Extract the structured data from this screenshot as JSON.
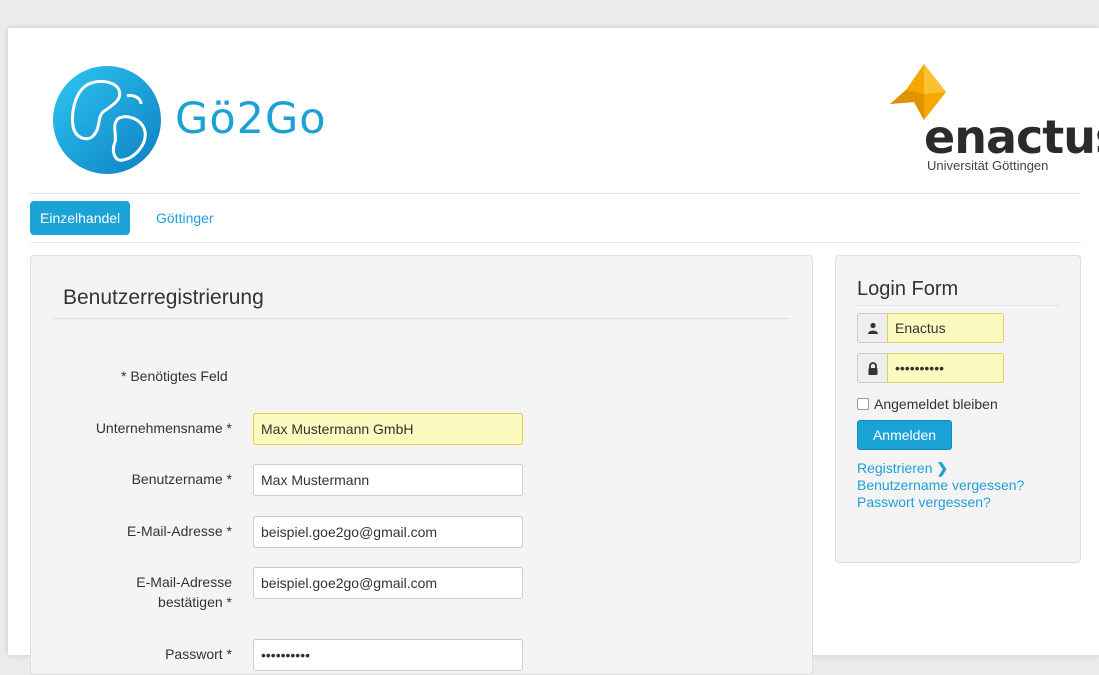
{
  "header": {
    "brand_name": "Gö2Go",
    "partner_name": "enactus",
    "partner_subtitle": "Universität Göttingen"
  },
  "nav": {
    "tabs": [
      {
        "label": "Einzelhandel",
        "active": true
      },
      {
        "label": "Göttinger",
        "active": false
      }
    ]
  },
  "registration": {
    "title": "Benutzerregistrierung",
    "required_note": "* Benötigtes Feld",
    "fields": [
      {
        "label": "Unternehmensname *",
        "value": "Max Mustermann GmbH"
      },
      {
        "label": "Benutzername *",
        "value": "Max Mustermann"
      },
      {
        "label": "E-Mail-Adresse *",
        "value": "beispiel.goe2go@gmail.com"
      },
      {
        "label": "E-Mail-Adresse bestätigen *",
        "value": "beispiel.goe2go@gmail.com"
      },
      {
        "label": "Passwort *",
        "value": "••••••••••"
      }
    ]
  },
  "login": {
    "title": "Login Form",
    "username_value": "Enactus",
    "password_value": "••••••••••",
    "remember_label": "Angemeldet bleiben",
    "submit_label": "Anmelden",
    "links": {
      "register": "Registrieren",
      "forgot_username": "Benutzername vergessen?",
      "forgot_password": "Passwort vergessen?"
    }
  },
  "colors": {
    "accent": "#1aa3d6",
    "autofill": "#fbfbbf",
    "partner_yellow": "#f5a800"
  }
}
